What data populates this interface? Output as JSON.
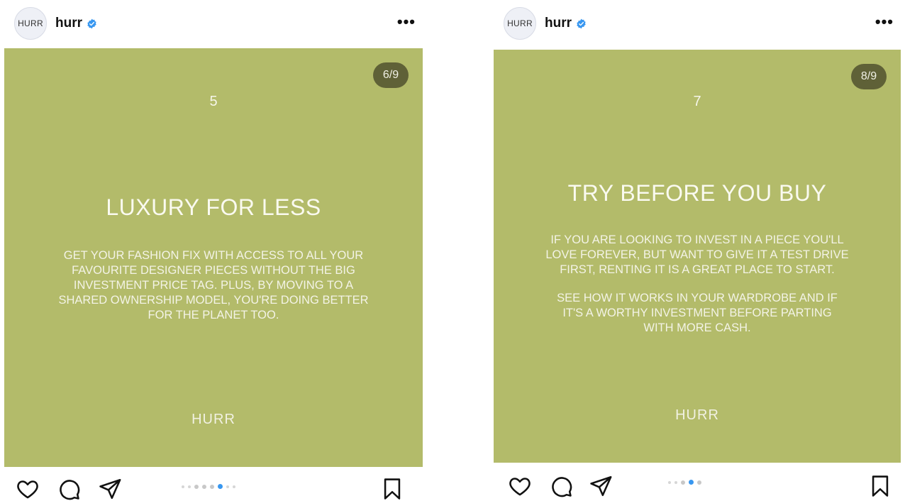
{
  "posts": [
    {
      "avatar_text": "HURR",
      "username": "hurr",
      "more_label": "•••",
      "counter": "6/9",
      "number": "5",
      "headline": "LUXURY FOR LESS",
      "body_lines": [
        "GET YOUR FASHION FIX WITH ACCESS TO ALL YOUR",
        "FAVOURITE DESIGNER PIECES WITHOUT THE BIG",
        "INVESTMENT PRICE TAG. PLUS, BY MOVING TO A",
        "SHARED OWNERSHIP MODEL, YOU'RE DOING BETTER",
        "FOR THE PLANET TOO."
      ],
      "brand": "HURR"
    },
    {
      "avatar_text": "HURR",
      "username": "hurr",
      "more_label": "•••",
      "counter": "8/9",
      "number": "7",
      "headline": "TRY BEFORE YOU BUY",
      "body_lines": [
        "IF YOU ARE LOOKING TO INVEST IN A PIECE YOU'LL",
        "LOVE FOREVER, BUT WANT TO GIVE IT A TEST DRIVE",
        "FIRST, RENTING IT IS A GREAT PLACE TO START.",
        "",
        "SEE HOW IT WORKS IN YOUR WARDROBE AND IF",
        "IT'S A WORTHY INVESTMENT BEFORE PARTING",
        "WITH MORE CASH."
      ],
      "brand": "HURR"
    }
  ],
  "icons": {
    "like": "heart-icon",
    "comment": "comment-icon",
    "share": "send-icon",
    "save": "bookmark-icon",
    "verified": "verified-badge-icon",
    "more": "more-options-icon"
  },
  "colors": {
    "slide_background": "#b3bb6a",
    "counter_background": "#5f6137",
    "verified": "#3897f0",
    "active_dot": "#3897f0"
  }
}
